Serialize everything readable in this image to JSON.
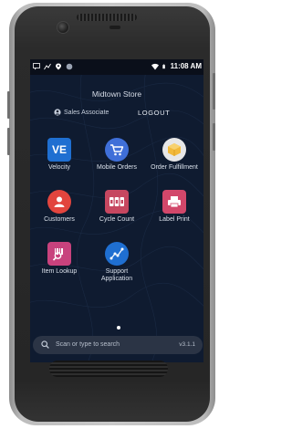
{
  "statusbar": {
    "icons_left": [
      "chat-icon",
      "chart-icon",
      "location-icon",
      "record-icon"
    ],
    "time": "11:08 AM",
    "icons_right": [
      "wifi-icon",
      "battery-icon"
    ]
  },
  "header": {
    "store_name": "Midtown Store",
    "role": "Sales Associate",
    "logout_label": "LOGOUT"
  },
  "apps": [
    {
      "label": "Velocity",
      "icon": "velocity-icon",
      "icon_text": "VE",
      "color": "#1f6fd1"
    },
    {
      "label": "Mobile Orders",
      "icon": "shopping-cart-icon",
      "color": "#3f6fd8"
    },
    {
      "label": "Order Fulfillment",
      "icon": "package-icon",
      "color": "#f2c14e"
    },
    {
      "label": "Customers",
      "icon": "customer-icon",
      "color": "#e2453e"
    },
    {
      "label": "Cycle Count",
      "icon": "counter-icon",
      "color": "#c64760"
    },
    {
      "label": "Label Print",
      "icon": "printer-icon",
      "color": "#d2476a"
    },
    {
      "label": "Item Lookup",
      "icon": "barcode-scan-icon",
      "color": "#c8427d"
    },
    {
      "label": "Support Application",
      "label_line1": "Support",
      "label_line2": "Application",
      "icon": "support-graph-icon",
      "color": "#1f6fd1"
    }
  ],
  "search": {
    "placeholder": "Scan or type to search",
    "version": "v3.1.1"
  }
}
